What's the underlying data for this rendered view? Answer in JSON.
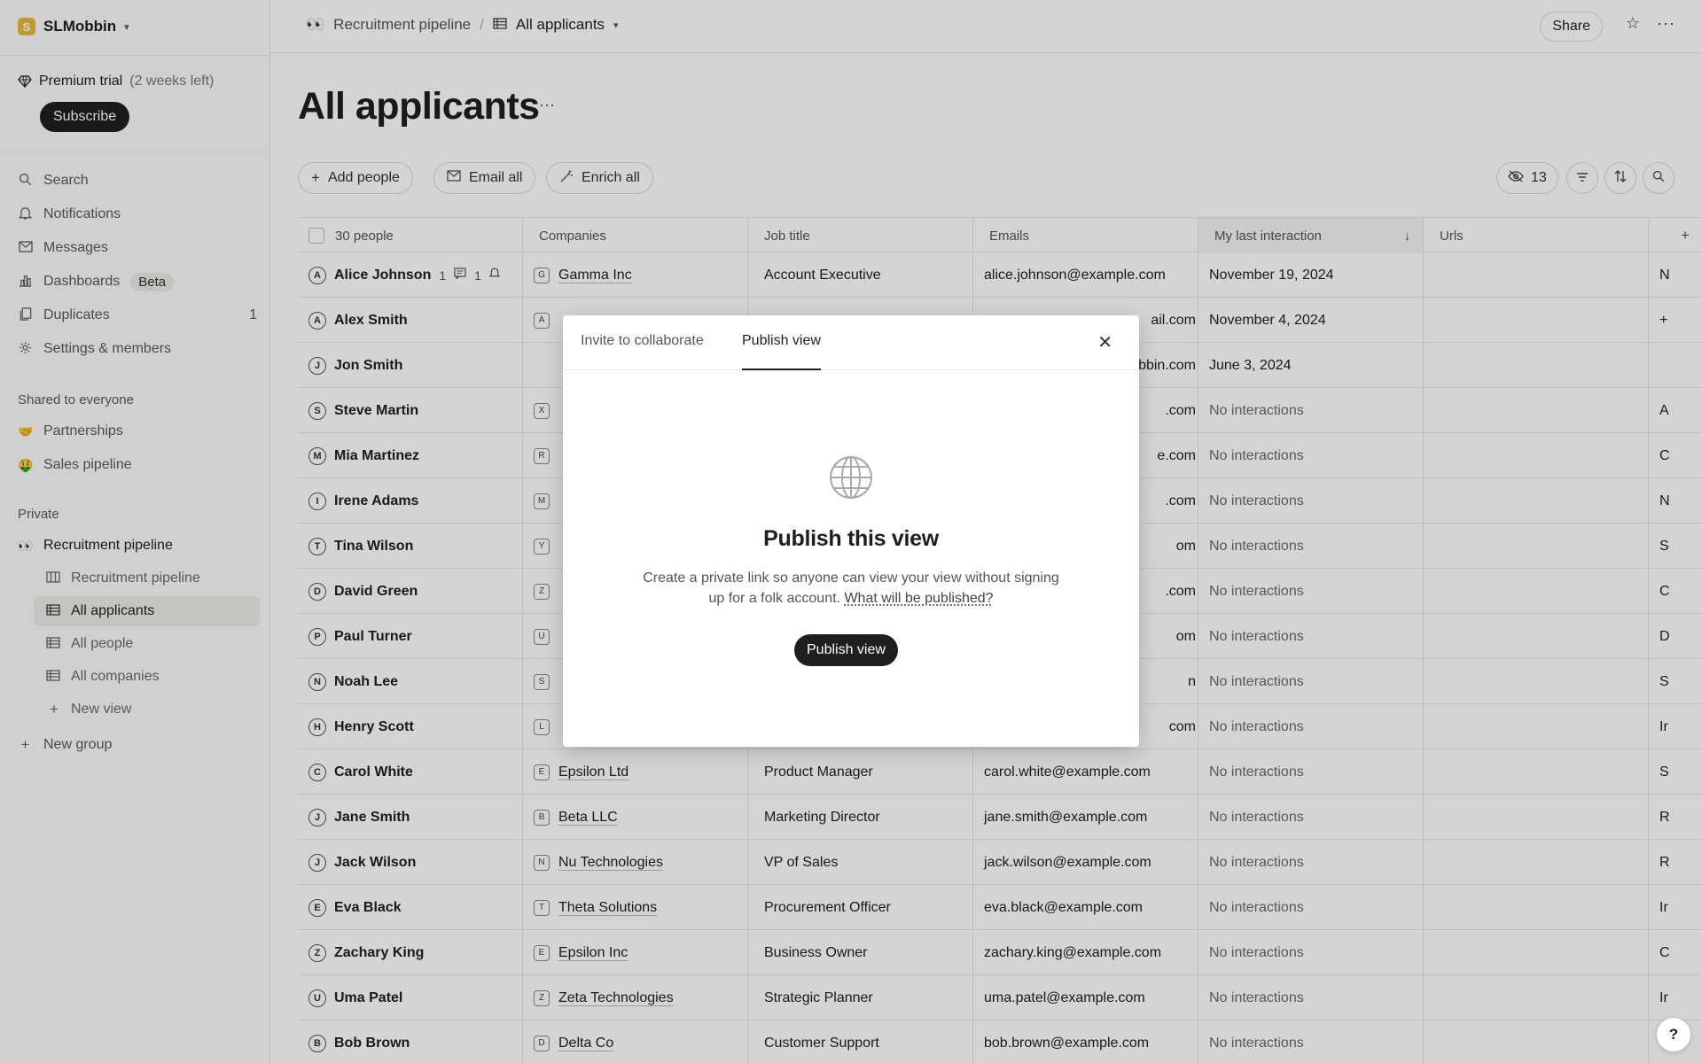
{
  "workspace": {
    "initial": "S",
    "name": "SLMobbin"
  },
  "trial": {
    "label": "Premium trial",
    "remaining": "(2 weeks left)",
    "subscribe": "Subscribe"
  },
  "nav": {
    "search": "Search",
    "notifications": "Notifications",
    "messages": "Messages",
    "dashboards": "Dashboards",
    "dashboards_badge": "Beta",
    "duplicates": "Duplicates",
    "duplicates_count": "1",
    "settings": "Settings & members"
  },
  "shared": {
    "title": "Shared to everyone",
    "items": [
      {
        "emoji": "🤝",
        "label": "Partnerships"
      },
      {
        "emoji": "🤑",
        "label": "Sales pipeline"
      }
    ]
  },
  "private": {
    "title": "Private",
    "group": {
      "emoji": "👀",
      "label": "Recruitment pipeline"
    },
    "views": [
      "Recruitment pipeline",
      "All applicants",
      "All people",
      "All companies"
    ],
    "new_view": "New view",
    "new_group": "New group"
  },
  "topbar": {
    "crumb_emoji": "👀",
    "crumb_parent": "Recruitment pipeline",
    "separator": "/",
    "crumb_current": "All applicants",
    "share": "Share"
  },
  "page": {
    "title": "All applicants"
  },
  "toolbar": {
    "add_people": "Add people",
    "email_all": "Email all",
    "enrich_all": "Enrich all",
    "hidden_count": "13"
  },
  "table": {
    "columns": {
      "people": "30 people",
      "companies": "Companies",
      "job": "Job title",
      "emails": "Emails",
      "last": "My last interaction",
      "urls": "Urls"
    },
    "rows": [
      {
        "initial": "A",
        "name": "Alice Johnson",
        "comments": "1",
        "reminders": "1",
        "comp_initial": "G",
        "company": "Gamma Inc",
        "job": "Account Executive",
        "email": "alice.johnson@example.com",
        "last": "November 19, 2024",
        "more": "N"
      },
      {
        "initial": "A",
        "name": "Alex Smith",
        "comp_initial": "A",
        "company": "",
        "job": "",
        "email": "ail.com",
        "last": "November 4, 2024",
        "more": "+"
      },
      {
        "initial": "J",
        "name": "Jon Smith",
        "comp_initial": "",
        "company": "",
        "job": "",
        "email": "obbin.com",
        "last": "June 3, 2024",
        "more": ""
      },
      {
        "initial": "S",
        "name": "Steve Martin",
        "comp_initial": "X",
        "company": "",
        "job": "",
        "email": ".com",
        "last": "No interactions",
        "more": "A"
      },
      {
        "initial": "M",
        "name": "Mia Martinez",
        "comp_initial": "R",
        "company": "",
        "job": "",
        "email": "e.com",
        "last": "No interactions",
        "more": "C"
      },
      {
        "initial": "I",
        "name": "Irene Adams",
        "comp_initial": "M",
        "company": "",
        "job": "",
        "email": ".com",
        "last": "No interactions",
        "more": "N"
      },
      {
        "initial": "T",
        "name": "Tina Wilson",
        "comp_initial": "Y",
        "company": "",
        "job": "",
        "email": "om",
        "last": "No interactions",
        "more": "S"
      },
      {
        "initial": "D",
        "name": "David Green",
        "comp_initial": "Z",
        "company": "",
        "job": "",
        "email": ".com",
        "last": "No interactions",
        "more": "C"
      },
      {
        "initial": "P",
        "name": "Paul Turner",
        "comp_initial": "U",
        "company": "",
        "job": "",
        "email": "om",
        "last": "No interactions",
        "more": "D"
      },
      {
        "initial": "N",
        "name": "Noah Lee",
        "comp_initial": "S",
        "company": "",
        "job": "",
        "email": "n",
        "last": "No interactions",
        "more": "S"
      },
      {
        "initial": "H",
        "name": "Henry Scott",
        "comp_initial": "L",
        "company": "",
        "job": "",
        "email": "com",
        "last": "No interactions",
        "more": "Ir"
      },
      {
        "initial": "C",
        "name": "Carol White",
        "comp_initial": "E",
        "company": "Epsilon Ltd",
        "job": "Product Manager",
        "email": "carol.white@example.com",
        "last": "No interactions",
        "more": "S"
      },
      {
        "initial": "J",
        "name": "Jane Smith",
        "comp_initial": "B",
        "company": "Beta LLC",
        "job": "Marketing Director",
        "email": "jane.smith@example.com",
        "last": "No interactions",
        "more": "R"
      },
      {
        "initial": "J",
        "name": "Jack Wilson",
        "comp_initial": "N",
        "company": "Nu Technologies",
        "job": "VP of Sales",
        "email": "jack.wilson@example.com",
        "last": "No interactions",
        "more": "R"
      },
      {
        "initial": "E",
        "name": "Eva Black",
        "comp_initial": "T",
        "company": "Theta Solutions",
        "job": "Procurement Officer",
        "email": "eva.black@example.com",
        "last": "No interactions",
        "more": "Ir"
      },
      {
        "initial": "Z",
        "name": "Zachary King",
        "comp_initial": "E",
        "company": "Epsilon Inc",
        "job": "Business Owner",
        "email": "zachary.king@example.com",
        "last": "No interactions",
        "more": "C"
      },
      {
        "initial": "U",
        "name": "Uma Patel",
        "comp_initial": "Z",
        "company": "Zeta Technologies",
        "job": "Strategic Planner",
        "email": "uma.patel@example.com",
        "last": "No interactions",
        "more": "Ir"
      },
      {
        "initial": "B",
        "name": "Bob Brown",
        "comp_initial": "D",
        "company": "Delta Co",
        "job": "Customer Support",
        "email": "bob.brown@example.com",
        "last": "No interactions",
        "more": ""
      }
    ]
  },
  "modal": {
    "tab_invite": "Invite to collaborate",
    "tab_publish": "Publish view",
    "title": "Publish this view",
    "desc": "Create a private link so anyone can view your view without signing up for a folk account.",
    "desc_link": "What will be published?",
    "button": "Publish view"
  },
  "help": "?",
  "icons": [
    "diamond-icon",
    "search-icon",
    "bell-icon",
    "mail-icon",
    "chart-icon",
    "duplicate-icon",
    "gear-icon",
    "table-icon",
    "kanban-icon",
    "plus-icon",
    "star-icon",
    "more-icon",
    "eye-off-icon",
    "filter-icon",
    "sort-icon",
    "globe-icon",
    "close-icon",
    "chevron-down-icon"
  ]
}
